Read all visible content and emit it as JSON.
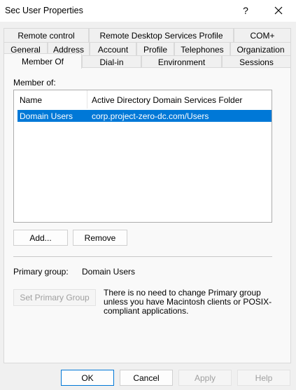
{
  "window": {
    "title": "Sec User Properties",
    "help_label": "?"
  },
  "tabs": {
    "row1": [
      "Remote control",
      "Remote Desktop Services Profile",
      "COM+"
    ],
    "row2": [
      "General",
      "Address",
      "Account",
      "Profile",
      "Telephones",
      "Organization"
    ],
    "row3": [
      "Member Of",
      "Dial-in",
      "Environment",
      "Sessions"
    ],
    "active": "Member Of"
  },
  "member_of": {
    "label": "Member of:",
    "columns": [
      "Name",
      "Active Directory Domain Services Folder"
    ],
    "rows": [
      {
        "name": "Domain Users",
        "folder": "corp.project-zero-dc.com/Users",
        "selected": true
      }
    ],
    "add_label": "Add...",
    "remove_label": "Remove"
  },
  "primary_group": {
    "label": "Primary group:",
    "value": "Domain Users",
    "set_button_label": "Set Primary Group",
    "note": "There is no need to change Primary group unless you have Macintosh clients or POSIX-compliant applications."
  },
  "footer": {
    "ok_label": "OK",
    "cancel_label": "Cancel",
    "apply_label": "Apply",
    "help_label": "Help"
  },
  "colors": {
    "selection": "#0078d7",
    "window_bg": "#f0f0f0",
    "panel_bg": "#f9f9f9"
  }
}
